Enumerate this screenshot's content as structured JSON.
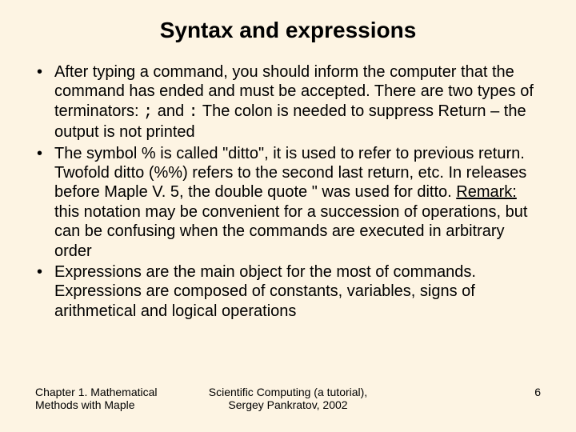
{
  "title": "Syntax and expressions",
  "bullets": {
    "b1a": "After typing a command, you should inform the computer that the command has ended and must be accepted. There are two types of terminators: ",
    "b1_sym1": ";",
    "b1b": " and ",
    "b1_sym2": ":",
    "b1c": "  The colon is needed to suppress Return – the output is not printed",
    "b2a": "The symbol % is called \"ditto\", it is used to refer to previous return. Twofold ditto (%%) refers to the second last return, etc. In releases before Maple V. 5, the double quote \" was used for ditto. ",
    "b2_remark": "Remark:",
    "b2b": " this notation may be convenient for a succession of operations, but can be confusing when the commands are executed in arbitrary order",
    "b3": "Expressions are the main object for the most of commands. Expressions are composed of constants, variables, signs of arithmetical and logical operations"
  },
  "footer": {
    "left_line1": "Chapter 1. Mathematical",
    "left_line2": "Methods with Maple",
    "center_line1": "Scientific Computing (a tutorial),",
    "center_line2": "Sergey Pankratov, 2002",
    "page": "6"
  }
}
